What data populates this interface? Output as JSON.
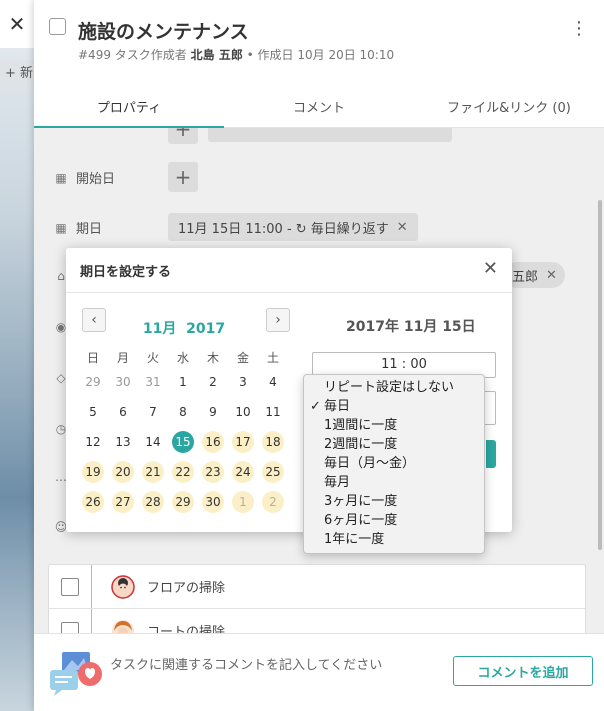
{
  "background": {
    "close": "✕",
    "new_label": "+ 新"
  },
  "header": {
    "title": "施設のメンテナンス",
    "meta_id": "#499",
    "meta_creator_label": "タスク作成者",
    "meta_creator": "北島 五郎",
    "meta_created": "• 作成日 10月 20日 10:10",
    "menu_icon": "⋮"
  },
  "tabs": [
    {
      "label": "プロパティ"
    },
    {
      "label": "コメント"
    },
    {
      "label": "ファイル&リンク (0)"
    }
  ],
  "properties": {
    "start_label": "開始日",
    "due_label": "期日",
    "due_value": "11月 15日 11:00 - ↻ 毎日繰り返す",
    "assignee_partial": "五郎"
  },
  "popup": {
    "title": "期日を設定する",
    "month": "11月",
    "year": "2017",
    "weekdays": [
      "日",
      "月",
      "火",
      "水",
      "木",
      "金",
      "土"
    ],
    "weeks": [
      [
        "29",
        "30",
        "31",
        "1",
        "2",
        "3",
        "4"
      ],
      [
        "5",
        "6",
        "7",
        "8",
        "9",
        "10",
        "11"
      ],
      [
        "12",
        "13",
        "14",
        "15",
        "16",
        "17",
        "18"
      ],
      [
        "19",
        "20",
        "21",
        "22",
        "23",
        "24",
        "25"
      ],
      [
        "26",
        "27",
        "28",
        "29",
        "30",
        "1",
        "2"
      ]
    ],
    "selected_date": "2017年 11月 15日",
    "time_hour": "11",
    "time_min": "00"
  },
  "repeat_menu": {
    "selected": "毎日",
    "options": [
      "リピート設定はしない",
      "毎日",
      "1週間に一度",
      "2週間に一度",
      "毎日（月〜金）",
      "毎月",
      "3ヶ月に一度",
      "6ヶ月に一度",
      "1年に一度"
    ]
  },
  "subtasks": [
    {
      "name": "フロアの掃除"
    },
    {
      "name": "コートの掃除"
    }
  ],
  "footer": {
    "placeholder": "タスクに関連するコメントを記入してください",
    "add_comment": "コメントを追加"
  },
  "colors": {
    "accent": "#2aa7a0",
    "highlight_day": "#fbefc7"
  }
}
